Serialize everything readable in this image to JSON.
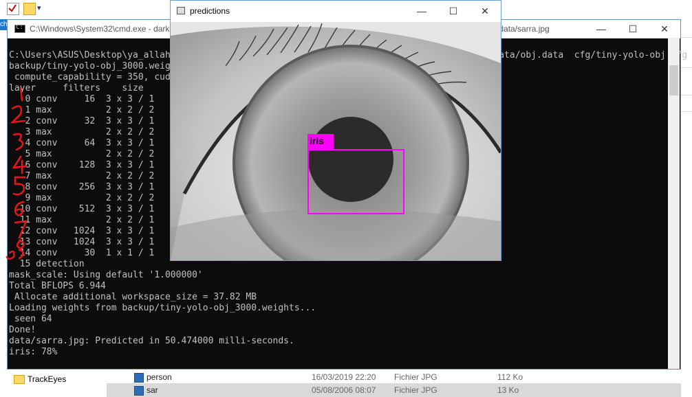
{
  "explorer": {
    "selected_tab_label": "ch",
    "nav_item": "TrackEyes",
    "files": [
      {
        "name": "person",
        "date": "16/03/2019 22:20",
        "type": "Fichier JPG",
        "size": "112 Ko"
      },
      {
        "name": "sar",
        "date": "05/08/2006 08:07",
        "type": "Fichier JPG",
        "size": "13 Ko"
      }
    ]
  },
  "cmd": {
    "title": "C:\\Windows\\System32\\cmd.exe - darknet.exe detector test data/obj.data cfg/tiny-yolo-obj.cfg backup/tiny-yolo-obj_3000.weights data/sarra.jpg",
    "lines": [
      "C:\\Users\\ASUS\\Desktop\\ya_allah\\darknet-master\\build\\darknet\\x64>darknet.exe detector test data/obj.data  cfg/tiny-yolo-obj.cfg",
      "backup/tiny-yolo-obj_3000.weights data/sarra.jpg",
      " compute_capability = 350, cudnn_half = 0",
      "layer     filters    size              input                output",
      "   0 conv     16  3 x 3 / 1",
      "   1 max          2 x 2 / 2",
      "   2 conv     32  3 x 3 / 1",
      "   3 max          2 x 2 / 2",
      "   4 conv     64  3 x 3 / 1",
      "   5 max          2 x 2 / 2",
      "   6 conv    128  3 x 3 / 1",
      "   7 max          2 x 2 / 2",
      "   8 conv    256  3 x 3 / 1",
      "   9 max          2 x 2 / 2",
      "  10 conv    512  3 x 3 / 1",
      "  11 max          2 x 2 / 1",
      "  12 conv   1024  3 x 3 / 1",
      "  13 conv   1024  3 x 3 / 1",
      "  14 conv     30  1 x 1 / 1",
      "  15 detection",
      "mask_scale: Using default '1.000000'",
      "Total BFLOPS 6.944",
      " Allocate additional workspace_size = 37.82 MB",
      "Loading weights from backup/tiny-yolo-obj_3000.weights...",
      " seen 64",
      "Done!",
      "data/sarra.jpg: Predicted in 50.474000 milli-seconds.",
      "iris: 78%"
    ]
  },
  "predictions": {
    "title": "predictions",
    "detection_label": "iris",
    "detection_color": "#ff00ff"
  },
  "window_buttons": {
    "minimize": "—",
    "maximize": "☐",
    "close": "✕"
  }
}
